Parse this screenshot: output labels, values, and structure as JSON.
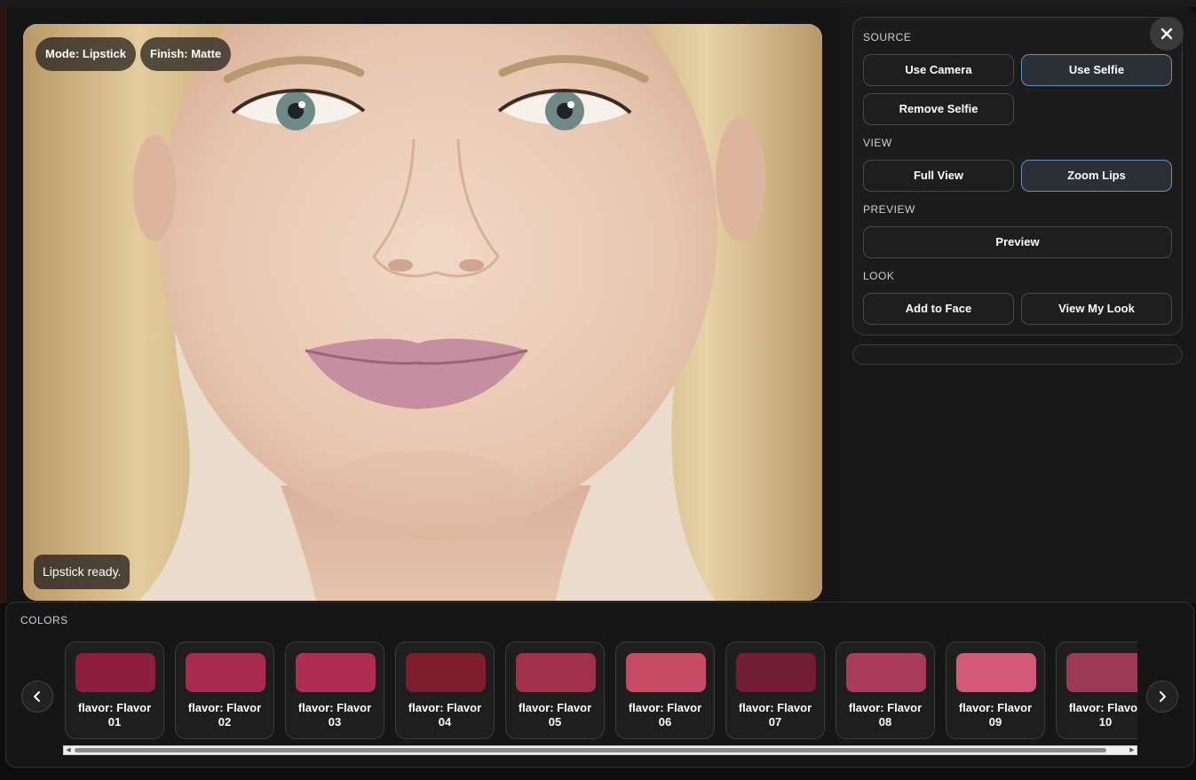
{
  "photo": {
    "mode_chip": "Mode: Lipstick",
    "finish_chip": "Finish: Matte",
    "status": "Lipstick ready.",
    "lip_color": "#c58fa1"
  },
  "panel": {
    "source": {
      "title": "SOURCE",
      "use_camera": "Use Camera",
      "use_selfie": "Use Selfie",
      "remove_selfie": "Remove Selfie"
    },
    "view": {
      "title": "VIEW",
      "full_view": "Full View",
      "zoom_lips": "Zoom Lips"
    },
    "preview": {
      "title": "PREVIEW",
      "preview_button": "Preview"
    },
    "look": {
      "title": "LOOK",
      "add_to_face": "Add to Face",
      "view_my_look": "View My Look"
    },
    "close_icon": "close-icon",
    "active_color": "#6a8fc7"
  },
  "colors": {
    "title": "COLORS",
    "prev_icon": "chevron-left-icon",
    "next_icon": "chevron-right-icon",
    "swatches": [
      {
        "line1": "flavor: Flavor",
        "line2": "01",
        "color": "#8c1f3e"
      },
      {
        "line1": "flavor: Flavor",
        "line2": "02",
        "color": "#a82a4e"
      },
      {
        "line1": "flavor: Flavor",
        "line2": "03",
        "color": "#b02d52"
      },
      {
        "line1": "flavor: Flavor",
        "line2": "04",
        "color": "#7e1d2e"
      },
      {
        "line1": "flavor: Flavor",
        "line2": "05",
        "color": "#a3304a"
      },
      {
        "line1": "flavor: Flavor",
        "line2": "06",
        "color": "#c74b64"
      },
      {
        "line1": "flavor: Flavor",
        "line2": "07",
        "color": "#731d34"
      },
      {
        "line1": "flavor: Flavor",
        "line2": "08",
        "color": "#a83b5a"
      },
      {
        "line1": "flavor: Flavor",
        "line2": "09",
        "color": "#d25a76"
      },
      {
        "line1": "flavor: Flavor",
        "line2": "10",
        "color": "#9c3a55"
      }
    ]
  }
}
